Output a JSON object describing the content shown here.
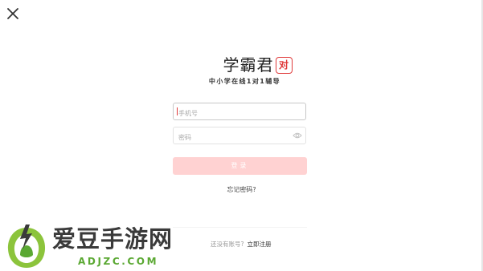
{
  "app": {
    "logo_text": "学霸君",
    "logo_badge": "对",
    "slogan": "中小学在线1对1辅导"
  },
  "form": {
    "phone_placeholder": "手机号",
    "password_placeholder": "密码",
    "login_label": "登录",
    "forgot_label": "忘记密码?"
  },
  "footer": {
    "register_prompt": "还没有账号?",
    "register_link": "立即注册"
  },
  "watermark": {
    "name": "爱豆手游网",
    "url": "ADJZC.COM"
  },
  "icons": {
    "close": "close-icon",
    "password_visibility": "eye-icon"
  },
  "colors": {
    "brand_red": "#e03b3b",
    "login_button_disabled": "#ffd2d2",
    "watermark_green": "#5aa832"
  }
}
